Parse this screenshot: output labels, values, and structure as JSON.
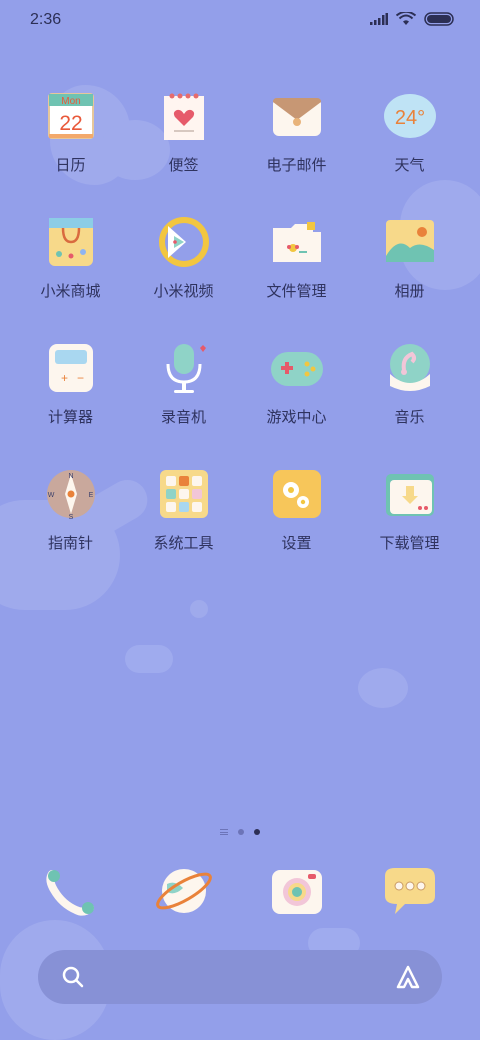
{
  "status_bar": {
    "time": "2:36",
    "icons": [
      "signal-icon",
      "wifi-icon",
      "battery-icon"
    ]
  },
  "apps": [
    {
      "name": "calendar",
      "label": "日历",
      "icon": "calendar-icon",
      "icon_text_top": "Mon",
      "icon_text_main": "22"
    },
    {
      "name": "notes",
      "label": "便签",
      "icon": "notes-icon"
    },
    {
      "name": "email",
      "label": "电子邮件",
      "icon": "email-icon"
    },
    {
      "name": "weather",
      "label": "天气",
      "icon": "weather-icon",
      "icon_text_main": "24°"
    },
    {
      "name": "mi-store",
      "label": "小米商城",
      "icon": "shopping-bag-icon"
    },
    {
      "name": "mi-video",
      "label": "小米视频",
      "icon": "video-icon"
    },
    {
      "name": "file-manager",
      "label": "文件管理",
      "icon": "folder-icon"
    },
    {
      "name": "gallery",
      "label": "相册",
      "icon": "gallery-icon"
    },
    {
      "name": "calculator",
      "label": "计算器",
      "icon": "calculator-icon"
    },
    {
      "name": "recorder",
      "label": "录音机",
      "icon": "microphone-icon"
    },
    {
      "name": "game-center",
      "label": "游戏中心",
      "icon": "gamepad-icon"
    },
    {
      "name": "music",
      "label": "音乐",
      "icon": "music-icon"
    },
    {
      "name": "compass",
      "label": "指南针",
      "icon": "compass-icon",
      "compass": {
        "n": "N",
        "s": "S",
        "e": "E",
        "w": "W"
      }
    },
    {
      "name": "system-tools",
      "label": "系统工具",
      "icon": "tools-folder-icon"
    },
    {
      "name": "settings",
      "label": "设置",
      "icon": "settings-icon"
    },
    {
      "name": "downloads",
      "label": "下载管理",
      "icon": "download-icon"
    }
  ],
  "page_indicator": {
    "pages": 2,
    "current": 2
  },
  "dock": [
    {
      "name": "phone",
      "icon": "phone-icon"
    },
    {
      "name": "browser",
      "icon": "planet-icon"
    },
    {
      "name": "camera",
      "icon": "camera-icon"
    },
    {
      "name": "messages",
      "icon": "message-icon"
    }
  ],
  "search_bar": {
    "left_icon": "search-icon",
    "right_icon": "assistant-icon"
  },
  "colors": {
    "background": "#939FEA",
    "text": "#2F335F",
    "search_bar": "#8791D6"
  }
}
